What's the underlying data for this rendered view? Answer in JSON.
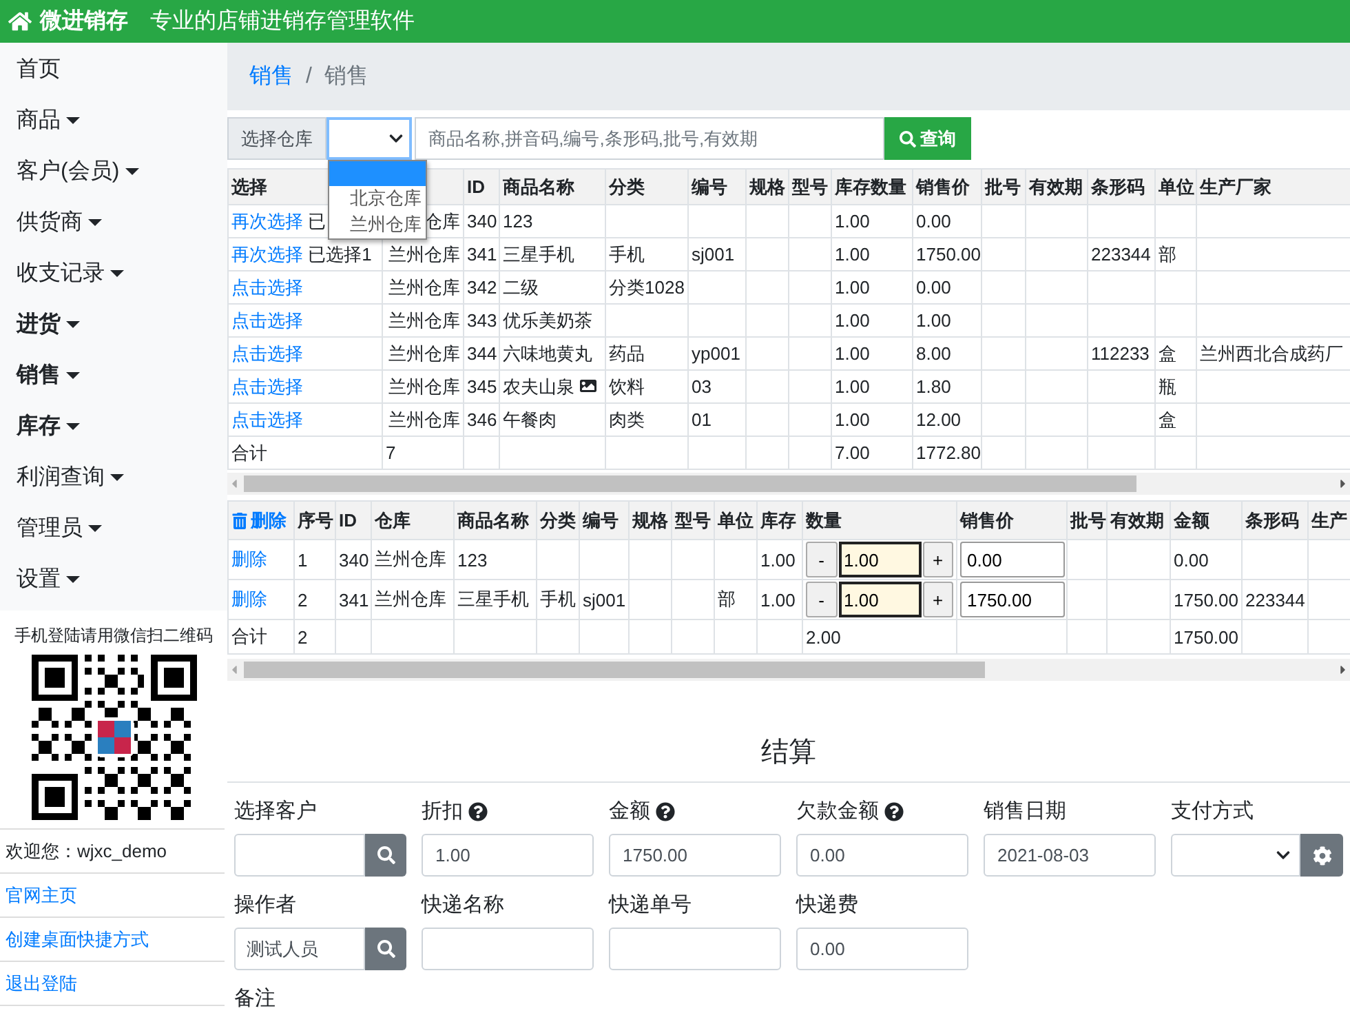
{
  "header": {
    "brand": "微进销存",
    "slogan": "专业的店铺进销存管理软件"
  },
  "sidebar": {
    "items": [
      {
        "label": "首页",
        "dropdown": false,
        "emphasized": false
      },
      {
        "label": "商品",
        "dropdown": true,
        "emphasized": false
      },
      {
        "label": "客户(会员)",
        "dropdown": true,
        "emphasized": false
      },
      {
        "label": "供货商",
        "dropdown": true,
        "emphasized": false
      },
      {
        "label": "收支记录",
        "dropdown": true,
        "emphasized": false
      },
      {
        "label": "进货",
        "dropdown": true,
        "emphasized": true
      },
      {
        "label": "销售",
        "dropdown": true,
        "emphasized": true
      },
      {
        "label": "库存",
        "dropdown": true,
        "emphasized": true
      },
      {
        "label": "利润查询",
        "dropdown": true,
        "emphasized": false
      },
      {
        "label": "管理员",
        "dropdown": true,
        "emphasized": false
      },
      {
        "label": "设置",
        "dropdown": true,
        "emphasized": false
      }
    ],
    "qr_caption": "手机登陆请用微信扫二维码",
    "links": [
      {
        "label": "欢迎您：wjxc_demo",
        "kind": "text"
      },
      {
        "label": "官网主页",
        "kind": "link"
      },
      {
        "label": "创建桌面快捷方式",
        "kind": "link"
      },
      {
        "label": "退出登陆",
        "kind": "link"
      }
    ]
  },
  "breadcrumb": [
    {
      "label": "销售",
      "kind": "link"
    },
    {
      "label": "/",
      "kind": "separator"
    },
    {
      "label": "销售",
      "kind": "current"
    }
  ],
  "toolbar": {
    "warehouse_label": "选择仓库",
    "search_placeholder": "商品名称,拼音码,编号,条形码,批号,有效期",
    "search_button": "查询",
    "dropdown": {
      "expanded": true,
      "blank_selected": true,
      "options": [
        {
          "label": "北京仓库",
          "selected": false
        },
        {
          "label": "兰州仓库",
          "selected": false
        }
      ]
    }
  },
  "products": {
    "columns": [
      "选择",
      "",
      "ID",
      "商品名称",
      "分类",
      "编号",
      "规格",
      "型号",
      "库存数量",
      "销售价",
      "批号",
      "有效期",
      "条形码",
      "单位",
      "生产厂家"
    ],
    "rows": [
      {
        "kind": "item",
        "note": "已",
        "has_image": false,
        "cells": [
          "再次选择",
          "仓库",
          "340",
          "123",
          "",
          "",
          "",
          "",
          "1.00",
          "0.00",
          "",
          "",
          "",
          "",
          ""
        ]
      },
      {
        "kind": "item",
        "note": "已选择1",
        "has_image": false,
        "cells": [
          "再次选择",
          "兰州仓库",
          "341",
          "三星手机",
          "手机",
          "sj001",
          "",
          "",
          "1.00",
          "1750.00",
          "",
          "",
          "223344",
          "部",
          ""
        ]
      },
      {
        "kind": "item",
        "has_image": false,
        "cells": [
          "点击选择",
          "兰州仓库",
          "342",
          "二级",
          "分类1028",
          "",
          "",
          "",
          "1.00",
          "0.00",
          "",
          "",
          "",
          "",
          ""
        ]
      },
      {
        "kind": "item",
        "has_image": false,
        "cells": [
          "点击选择",
          "兰州仓库",
          "343",
          "优乐美奶茶",
          "",
          "",
          "",
          "",
          "1.00",
          "1.00",
          "",
          "",
          "",
          "",
          ""
        ]
      },
      {
        "kind": "item",
        "has_image": false,
        "cells": [
          "点击选择",
          "兰州仓库",
          "344",
          "六味地黄丸",
          "药品",
          "yp001",
          "",
          "",
          "1.00",
          "8.00",
          "",
          "",
          "112233",
          "盒",
          "兰州西北合成药厂"
        ]
      },
      {
        "kind": "item",
        "has_image": true,
        "cells": [
          "点击选择",
          "兰州仓库",
          "345",
          "农夫山泉",
          "饮料",
          "03",
          "",
          "",
          "1.00",
          "1.80",
          "",
          "",
          "",
          "瓶",
          ""
        ]
      },
      {
        "kind": "item",
        "has_image": false,
        "cells": [
          "点击选择",
          "兰州仓库",
          "346",
          "午餐肉",
          "肉类",
          "01",
          "",
          "",
          "1.00",
          "12.00",
          "",
          "",
          "",
          "盒",
          ""
        ]
      },
      {
        "kind": "total",
        "has_image": false,
        "cells": [
          "合计",
          "7",
          "",
          "",
          "",
          "",
          "",
          "",
          "7.00",
          "1772.80",
          "",
          "",
          "",
          "",
          ""
        ]
      }
    ]
  },
  "cart": {
    "columns": [
      "删除",
      "序号",
      "ID",
      "仓库",
      "商品名称",
      "分类",
      "编号",
      "规格",
      "型号",
      "单位",
      "库存",
      "数量",
      "销售价",
      "批号",
      "有效期",
      "金额",
      "条形码",
      "生产"
    ],
    "rows": [
      {
        "kind": "item",
        "minus": "-",
        "plus": "+",
        "cells": [
          "删除",
          "1",
          "340",
          "兰州仓库",
          "123",
          "",
          "",
          "",
          "",
          "",
          "1.00",
          "1.00",
          "0.00",
          "",
          "",
          "0.00",
          "",
          ""
        ]
      },
      {
        "kind": "item",
        "minus": "-",
        "plus": "+",
        "cells": [
          "删除",
          "2",
          "341",
          "兰州仓库",
          "三星手机",
          "手机",
          "sj001",
          "",
          "",
          "部",
          "1.00",
          "1.00",
          "1750.00",
          "",
          "",
          "1750.00",
          "223344",
          ""
        ]
      },
      {
        "kind": "total",
        "cells": [
          "合计",
          "2",
          "",
          "",
          "",
          "",
          "",
          "",
          "",
          "",
          "",
          "2.00",
          "",
          "",
          "",
          "1750.00",
          "",
          ""
        ]
      }
    ]
  },
  "settlement": {
    "title": "结算",
    "rows": [
      [
        {
          "label": "选择客户",
          "kind": "lookup",
          "help": false
        },
        {
          "label": "折扣",
          "kind": "text",
          "help": true,
          "value": "1.00"
        },
        {
          "label": "金额",
          "kind": "text",
          "help": true,
          "value": "1750.00"
        },
        {
          "label": "欠款金额",
          "kind": "text",
          "help": true,
          "value": "0.00"
        },
        {
          "label": "销售日期",
          "kind": "text",
          "help": false,
          "value": "2021-08-03"
        },
        {
          "label": "支付方式",
          "kind": "select",
          "help": false
        }
      ],
      [
        {
          "label": "操作者",
          "kind": "lookup",
          "help": false,
          "value": "测试人员"
        },
        {
          "label": "快递名称",
          "kind": "text",
          "help": false
        },
        {
          "label": "快递单号",
          "kind": "text",
          "help": false
        },
        {
          "label": "快递费",
          "kind": "text",
          "help": false,
          "value": "0.00"
        }
      ],
      [
        {
          "label": "备注",
          "kind": "label",
          "help": false
        }
      ]
    ]
  }
}
